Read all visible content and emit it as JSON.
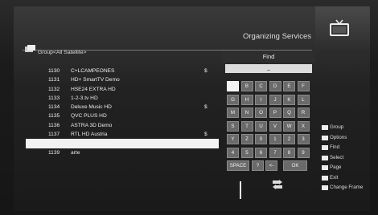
{
  "header": {
    "title": "Organizing Services",
    "group_label": "Group<All Satellite>"
  },
  "channels": [
    {
      "num": "1130",
      "name": "C+LCAMPEONES",
      "dollar": "$",
      "selected": false
    },
    {
      "num": "1131",
      "name": "HD+ SmartTV Demo",
      "dollar": "",
      "selected": false
    },
    {
      "num": "1132",
      "name": "HSE24 EXTRA HD",
      "dollar": "",
      "selected": false
    },
    {
      "num": "1133",
      "name": "1-2-3.tv HD",
      "dollar": "",
      "selected": false
    },
    {
      "num": "1134",
      "name": "Deluxe Music HD",
      "dollar": "$",
      "selected": false
    },
    {
      "num": "1135",
      "name": "QVC PLUS HD",
      "dollar": "",
      "selected": false
    },
    {
      "num": "1136",
      "name": "ASTRA 3D Demo",
      "dollar": "",
      "selected": false
    },
    {
      "num": "1137",
      "name": "RTL HD Austria",
      "dollar": "$",
      "selected": false
    },
    {
      "num": "",
      "name": "",
      "dollar": "",
      "selected": true
    },
    {
      "num": "1139",
      "name": "arte",
      "dollar": "",
      "selected": false
    }
  ],
  "find": {
    "title": "Find",
    "input_value": "_",
    "keys": [
      [
        "A",
        "B",
        "C",
        "D",
        "E",
        "F"
      ],
      [
        "G",
        "H",
        "I",
        "J",
        "K",
        "L"
      ],
      [
        "M",
        "N",
        "O",
        "P",
        "Q",
        "R"
      ],
      [
        "S",
        "T",
        "U",
        "V",
        "W",
        "X"
      ],
      [
        "Y",
        "Z",
        "0",
        "1",
        "2",
        "3"
      ],
      [
        "4",
        "5",
        "6",
        "7",
        "8",
        "9"
      ]
    ],
    "bottom_keys": [
      "SPACE",
      "?",
      "<-"
    ],
    "ok_label": "OK",
    "highlighted_key": "A"
  },
  "legend": [
    {
      "label": "Group",
      "icon": "red-button-icon"
    },
    {
      "label": "Options",
      "icon": "green-button-icon"
    },
    {
      "label": "Find",
      "icon": "find-button-icon"
    },
    {
      "label": "Select",
      "icon": "ok-button-icon"
    },
    {
      "label": "Page",
      "icon": "page-button-icon"
    },
    {
      "label": "Exit",
      "icon": "exit-button-icon"
    },
    {
      "label": "Change Frame",
      "icon": "change-frame-button-icon"
    }
  ]
}
